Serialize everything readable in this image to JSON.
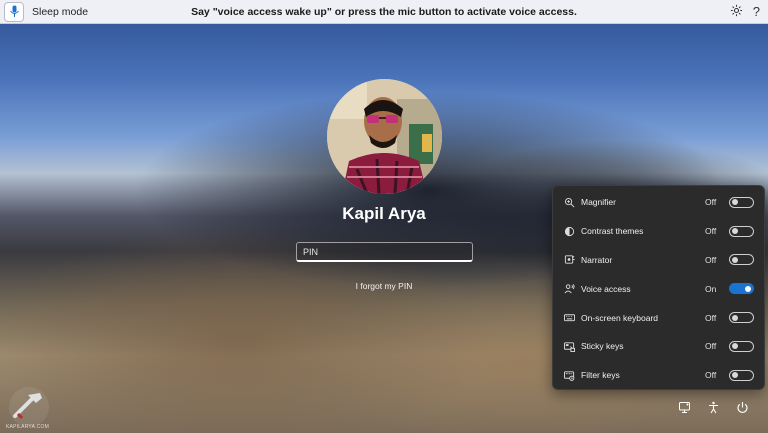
{
  "topbar": {
    "mic_icon": "mic-icon",
    "status": "Sleep mode",
    "instruction": "Say \"voice access wake up\" or press the mic button to activate voice access.",
    "settings_icon": "gear-icon",
    "help_label": "?"
  },
  "account": {
    "name": "Kapil Arya",
    "pin_placeholder": "PIN",
    "forgot_link": "I forgot my PIN"
  },
  "accessibility": {
    "items": [
      {
        "label": "Magnifier",
        "state": "Off",
        "icon": "magnifier-icon"
      },
      {
        "label": "Contrast themes",
        "state": "Off",
        "icon": "contrast-icon"
      },
      {
        "label": "Narrator",
        "state": "Off",
        "icon": "narrator-icon"
      },
      {
        "label": "Voice access",
        "state": "On",
        "icon": "voice-access-icon"
      },
      {
        "label": "On-screen keyboard",
        "state": "Off",
        "icon": "keyboard-icon"
      },
      {
        "label": "Sticky keys",
        "state": "Off",
        "icon": "sticky-keys-icon"
      },
      {
        "label": "Filter keys",
        "state": "Off",
        "icon": "filter-keys-icon"
      }
    ]
  },
  "bottom_icons": [
    "network-icon",
    "accessibility-icon",
    "power-icon"
  ],
  "watermark": {
    "text": "KAPILARYA.COM"
  },
  "colors": {
    "toggle_on": "#1a73d0",
    "flyout_bg": "#2b2b2b",
    "topbar_bg": "#eef0f6"
  }
}
